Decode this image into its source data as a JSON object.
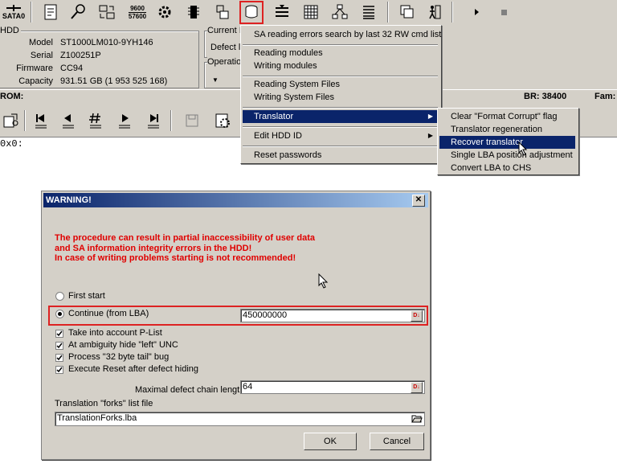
{
  "toolbar": {
    "sata_label": "SATA0",
    "speed_icon_label_top": "9600",
    "speed_icon_label_bottom": "57600"
  },
  "hdd": {
    "group_label": "HDD",
    "model_label": "Model",
    "model_value": "ST1000LM010-9YH146",
    "serial_label": "Serial",
    "serial_value": "Z100251P",
    "firmware_label": "Firmware",
    "firmware_value": "CC94",
    "capacity_label": "Capacity",
    "capacity_value": "931.51 GB (1 953 525 168)"
  },
  "current_group": {
    "label": "Current I",
    "defect_label": "Defect l",
    "operation_label": "Operatio"
  },
  "status_bar": {
    "rom_label": "ROM:",
    "br_label": "BR: 38400",
    "fam_label": "Fam:"
  },
  "output": {
    "line": "0x0:"
  },
  "main_menu": {
    "items": [
      "SA reading errors search by last 32 RW cmd list",
      "Reading modules",
      "Writing modules",
      "Reading System Files",
      "Writing System Files",
      "Translator",
      "Edit HDD ID",
      "Reset passwords"
    ]
  },
  "translator_menu": {
    "items": [
      "Clear \"Format Corrupt\" flag",
      "Translator regeneration",
      "Recover translator",
      "Single LBA position adjustment",
      "Convert LBA to CHS"
    ]
  },
  "dialog": {
    "title": "WARNING!",
    "close_glyph": "✕",
    "warning_lines": [
      "The procedure can result in partial inaccessibility of user data",
      "and SA information integrity errors in the HDD!",
      "In case of writing problems starting is not recommended!"
    ],
    "first_start_label": "First start",
    "continue_label": "Continue (from LBA)",
    "lba_value": "450000000",
    "checkboxes": [
      "Take into account P-List",
      "At ambiguity hide \"left\" UNC",
      "Process \"32 byte tail\" bug",
      "Execute Reset after defect hiding"
    ],
    "max_chain_label": "Maximal defect chain length",
    "max_chain_value": "64",
    "forks_label": "Translation \"forks\" list file",
    "forks_value": "TranslationForks.lba",
    "ok_label": "OK",
    "cancel_label": "Cancel"
  },
  "colors": {
    "highlight": "#0a246a",
    "warning_red": "#e00000",
    "annotation_red": "#dd2222"
  }
}
